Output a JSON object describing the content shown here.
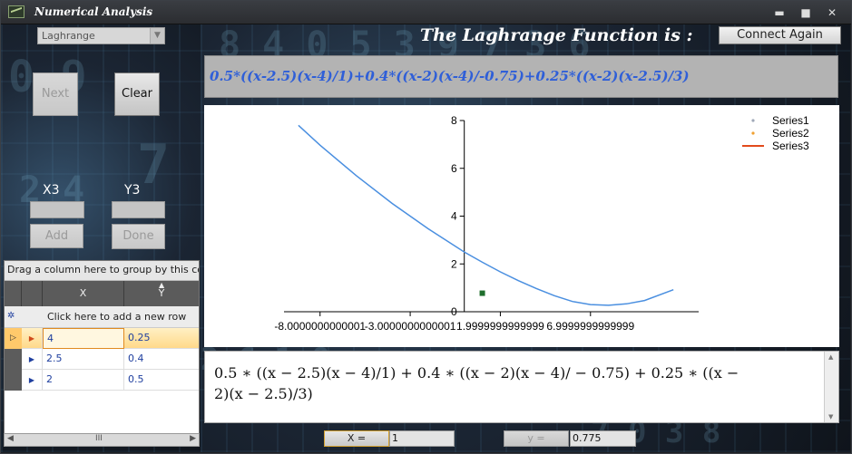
{
  "window": {
    "title": "Numerical Analysis",
    "controls": {
      "minimize": "▬",
      "maximize": "■",
      "close": "✕"
    }
  },
  "left": {
    "method_select": {
      "value": "Laghrange"
    },
    "next_label": "Next",
    "clear_label": "Clear",
    "x_label": "X3",
    "y_label": "Y3",
    "add_label": "Add",
    "done_label": "Done"
  },
  "grid": {
    "group_hint": "Drag a column here to group by this colu",
    "columns": [
      "X",
      "Y"
    ],
    "add_row": "Click here to add a new row",
    "rows": [
      {
        "x": "4",
        "y": "0.25"
      },
      {
        "x": "2.5",
        "y": "0.4"
      },
      {
        "x": "2",
        "y": "0.5"
      }
    ],
    "scroll_thumb": "III"
  },
  "header": {
    "title": "The Laghrange Function is :",
    "connect_label": "Connect Again"
  },
  "formula": "0.5*((x-2.5)(x-4)/1)+0.4*((x-2)(x-4)/-0.75)+0.25*((x-2)(x-2.5)/3)",
  "chart_data": {
    "type": "line",
    "x_ticks": [
      "-8.0000000000001",
      "-3.0000000000001",
      "1.9999999999999",
      "6.9999999999999"
    ],
    "y_ticks": [
      "0",
      "2",
      "4",
      "6",
      "8"
    ],
    "xlim": [
      -10,
      13
    ],
    "ylim": [
      0,
      8
    ],
    "series": [
      {
        "name": "Series1",
        "type": "point",
        "color": "#9fa8b8",
        "x": [],
        "y": []
      },
      {
        "name": "Series2",
        "type": "point",
        "color": "#f0a030",
        "x": [],
        "y": []
      },
      {
        "name": "Series3",
        "type": "line",
        "color": "#e24a1c",
        "x": [],
        "y": []
      },
      {
        "name": "",
        "type": "line",
        "color": "#4a8fe0",
        "x": [
          -9.2,
          -8,
          -6,
          -4,
          -2,
          0,
          1,
          2,
          3,
          4,
          5,
          6,
          7,
          8,
          9,
          10,
          11.6
        ],
        "y": [
          7.8,
          6.97,
          5.7,
          4.53,
          3.47,
          2.5,
          2.07,
          1.67,
          1.3,
          0.97,
          0.67,
          0.43,
          0.3,
          0.27,
          0.33,
          0.47,
          0.92
        ]
      },
      {
        "name": "",
        "type": "marker",
        "color": "#1f6e2c",
        "x": [
          1
        ],
        "y": [
          0.775
        ]
      }
    ],
    "legend": "top-right"
  },
  "result": {
    "line1": "0.5 ∗ ((x − 2.5)(x − 4)/1) + 0.4 ∗ ((x − 2)(x − 4)/ − 0.75) + 0.25 ∗ ((x −",
    "line2": "2)(x − 2.5)/3)"
  },
  "bottom": {
    "x_label": "X =",
    "x_value": "1",
    "y_label": "y =",
    "y_value": "0.775"
  }
}
